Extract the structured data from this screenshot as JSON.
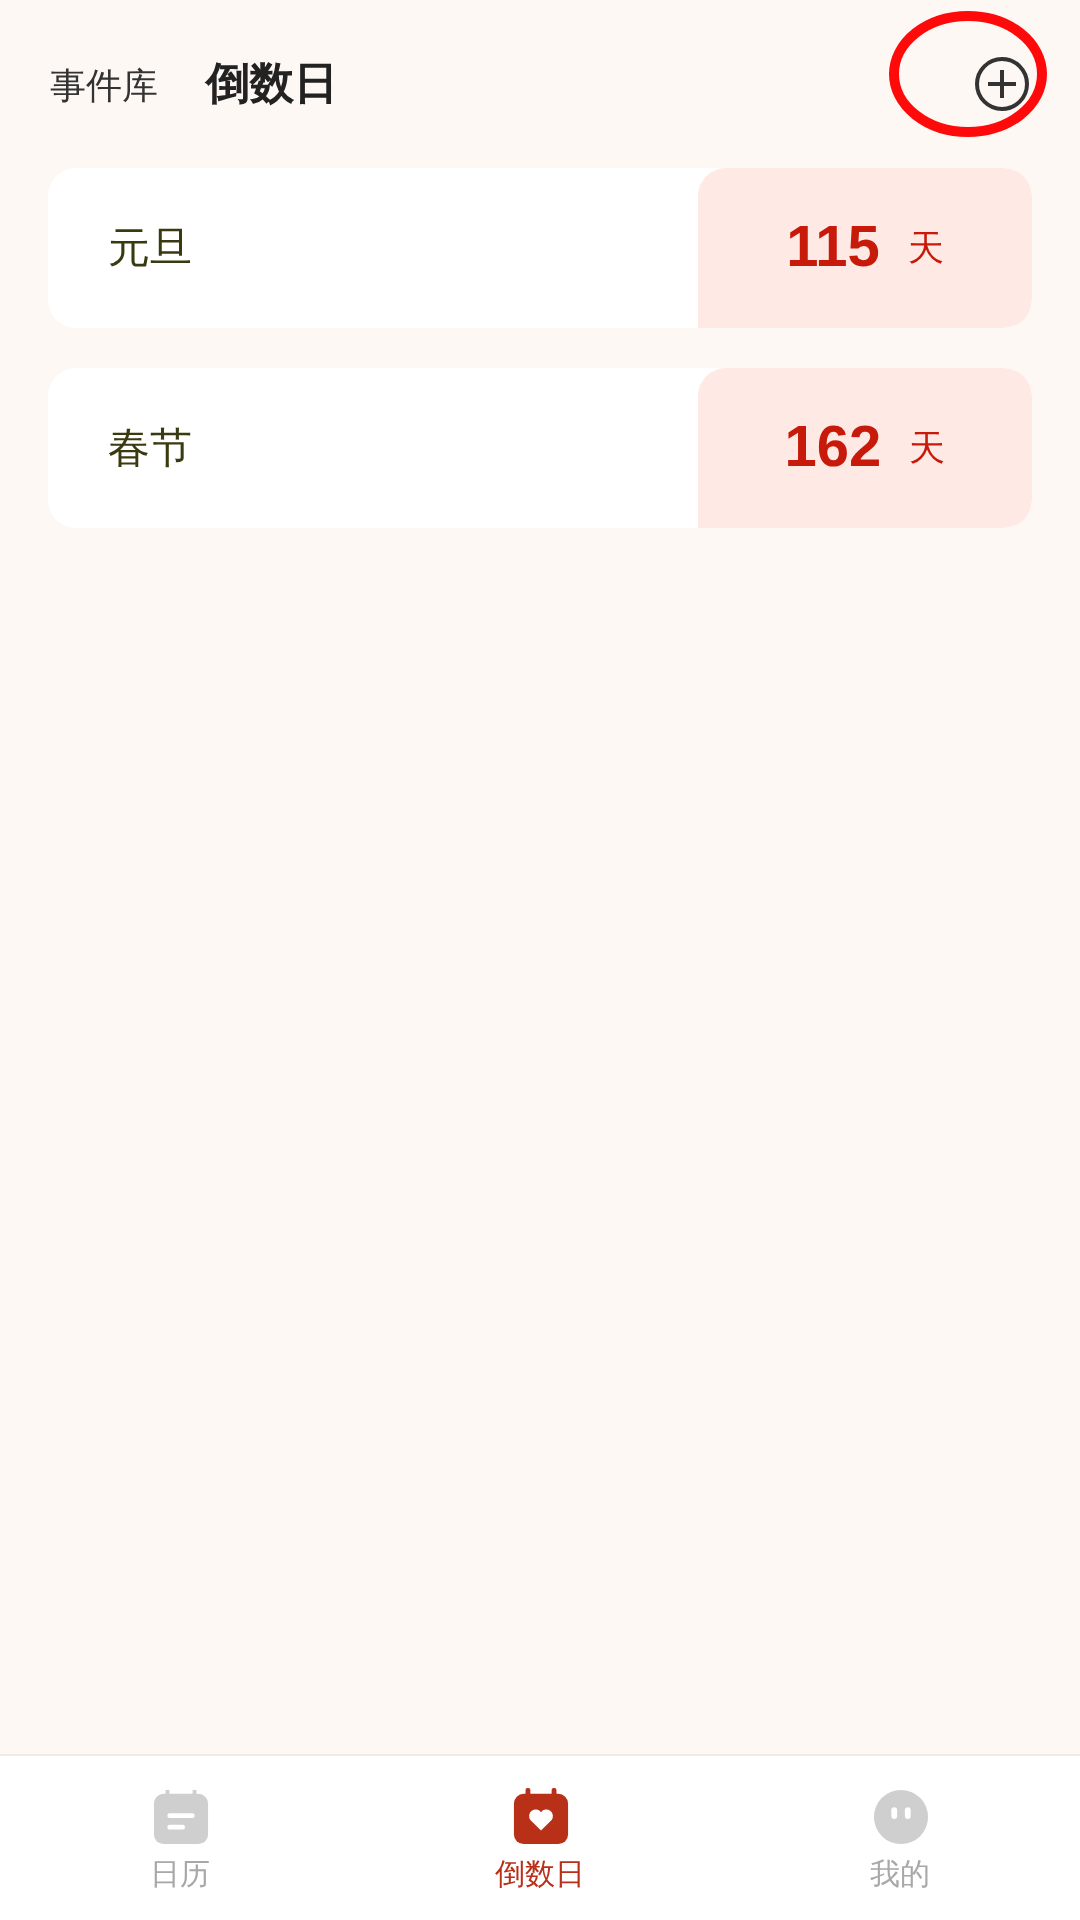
{
  "header_tabs": [
    {
      "label": "事件库",
      "selected": false
    },
    {
      "label": "倒数日",
      "selected": true
    }
  ],
  "events": [
    {
      "name": "元旦",
      "days": "115",
      "unit": "天"
    },
    {
      "name": "春节",
      "days": "162",
      "unit": "天"
    }
  ],
  "bottom_nav": [
    {
      "label": "日历",
      "kind": "calendar",
      "selected": false
    },
    {
      "label": "倒数日",
      "kind": "countdown",
      "selected": true
    },
    {
      "label": "我的",
      "kind": "profile",
      "selected": false
    }
  ]
}
